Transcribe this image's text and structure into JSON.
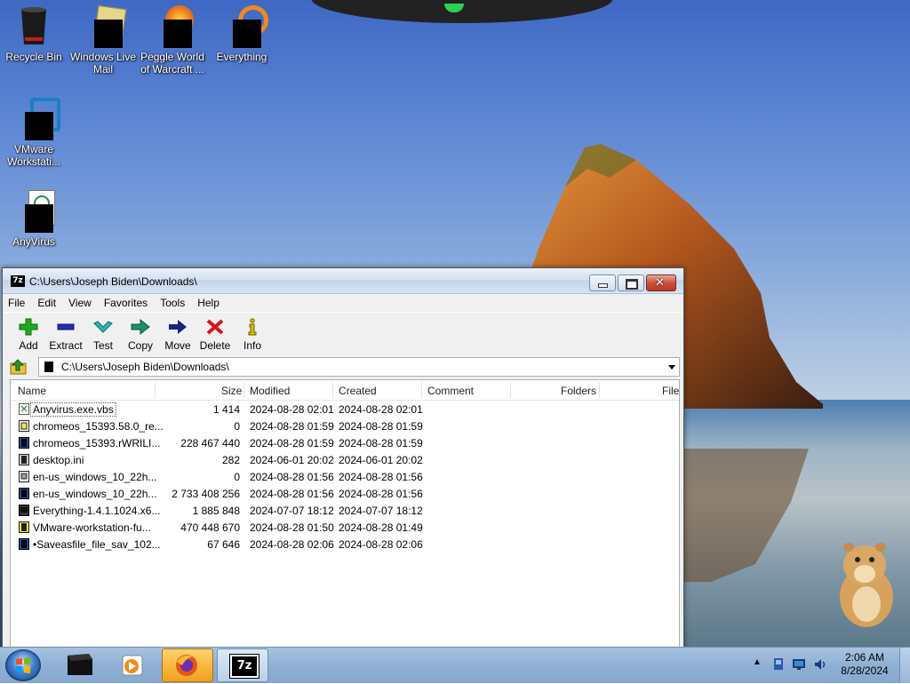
{
  "desktop": {
    "icons": [
      {
        "label": "Recycle Bin",
        "icon": "recycle-bin-icon"
      },
      {
        "label": "Windows Live Mail",
        "icon": "mail-icon"
      },
      {
        "label": "Peggle World of Warcraft ...",
        "icon": "game-icon"
      },
      {
        "label": "Everything",
        "icon": "search-app-icon"
      },
      {
        "label": "VMware Workstati...",
        "icon": "vmware-icon"
      },
      {
        "label": "AnyVirus",
        "icon": "script-file-icon"
      }
    ]
  },
  "window": {
    "title": "C:\\Users\\Joseph Biden\\Downloads\\",
    "app_icon_text": "7z",
    "menu": [
      "File",
      "Edit",
      "View",
      "Favorites",
      "Tools",
      "Help"
    ],
    "toolbar": [
      {
        "label": "Add",
        "icon": "plus-icon",
        "color": "#1fa81f"
      },
      {
        "label": "Extract",
        "icon": "minus-icon",
        "color": "#1f2fb0"
      },
      {
        "label": "Test",
        "icon": "check-icon",
        "color": "#2ab5b5"
      },
      {
        "label": "Copy",
        "icon": "copy-arrow-icon",
        "color": "#1a8f6a"
      },
      {
        "label": "Move",
        "icon": "move-arrow-icon",
        "color": "#1a237e"
      },
      {
        "label": "Delete",
        "icon": "x-icon",
        "color": "#d01818"
      },
      {
        "label": "Info",
        "icon": "info-icon",
        "color": "#d4c000"
      }
    ],
    "address": "C:\\Users\\Joseph Biden\\Downloads\\",
    "columns": [
      "Name",
      "Size",
      "Modified",
      "Created",
      "Comment",
      "Folders",
      "File"
    ],
    "files": [
      {
        "name": "Anyvirus.exe.vbs",
        "size": "1 414",
        "modified": "2024-08-28 02:01",
        "created": "2024-08-28 02:01",
        "icon": "script-file-icon"
      },
      {
        "name": "chromeos_15393.58.0_re...",
        "size": "0",
        "modified": "2024-08-28 01:59",
        "created": "2024-08-28 01:59",
        "icon": "archive-file-icon"
      },
      {
        "name": "chromeos_15393.rWRILI...",
        "size": "228 467 440",
        "modified": "2024-08-28 01:59",
        "created": "2024-08-28 01:59",
        "icon": "file-icon"
      },
      {
        "name": "desktop.ini",
        "size": "282",
        "modified": "2024-06-01 20:02",
        "created": "2024-06-01 20:02",
        "icon": "settings-file-icon"
      },
      {
        "name": "en-us_windows_10_22h...",
        "size": "0",
        "modified": "2024-08-28 01:56",
        "created": "2024-08-28 01:56",
        "icon": "disc-image-icon"
      },
      {
        "name": "en-us_windows_10_22h...",
        "size": "2 733 408 256",
        "modified": "2024-08-28 01:56",
        "created": "2024-08-28 01:56",
        "icon": "file-icon"
      },
      {
        "name": "Everything-1.4.1.1024.x6...",
        "size": "1 885 848",
        "modified": "2024-07-07 18:12",
        "created": "2024-07-07 18:12",
        "icon": "exe-file-icon"
      },
      {
        "name": "VMware-workstation-fu...",
        "size": "470 448 670",
        "modified": "2024-08-28 01:50",
        "created": "2024-08-28 01:49",
        "icon": "archive-file-icon"
      },
      {
        "name": "•Saveasfile_file_sav_102...",
        "size": "67 646",
        "modified": "2024-08-28 02:06",
        "created": "2024-08-28 02:06",
        "icon": "file-icon"
      }
    ]
  },
  "taskbar": {
    "pinned": [
      "start-orb",
      "file-explorer-icon",
      "media-player-icon",
      "firefox-icon",
      "7zip-icon"
    ],
    "seven_zip_label": "7z",
    "clock_time": "2:06 AM",
    "clock_date": "8/28/2024"
  },
  "colors": {
    "accent": "#3c6eb4",
    "close_button": "#c9503c",
    "taskbar": "#8fb0d4"
  }
}
